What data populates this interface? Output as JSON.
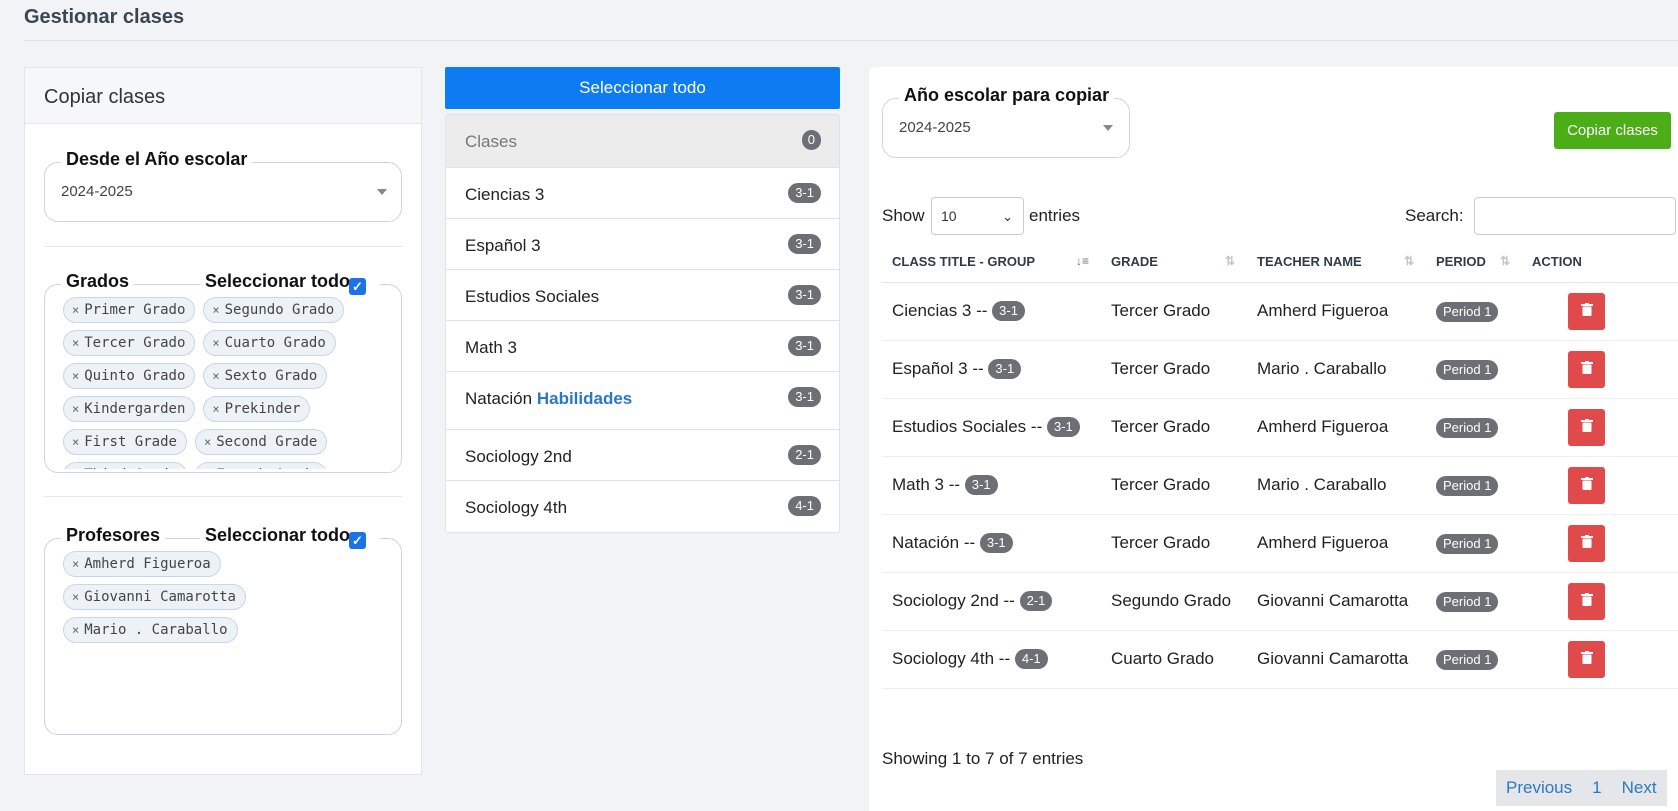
{
  "page": {
    "title": "Gestionar clases"
  },
  "left": {
    "card_title": "Copiar clases",
    "year_field": {
      "legend": "Desde el Año escolar",
      "value": "2024-2025"
    },
    "grades": {
      "legend": "Grados",
      "select_all_label": "Seleccionar todo",
      "chips": [
        "Primer Grado",
        "Segundo Grado",
        "Tercer Grado",
        "Cuarto Grado",
        "Quinto Grado",
        "Sexto Grado",
        "Kindergarden",
        "Prekinder",
        "First Grade",
        "Second Grade",
        "Third Grade",
        "Fourth Grade"
      ]
    },
    "teachers": {
      "legend": "Profesores",
      "select_all_label": "Seleccionar todo",
      "chips": [
        "Amherd Figueroa",
        "Giovanni Camarotta",
        "Mario . Caraballo"
      ]
    }
  },
  "middle": {
    "select_all_button": "Seleccionar todo",
    "header": {
      "label": "Clases",
      "count": "0"
    },
    "items": [
      {
        "name": "Ciencias 3",
        "highlight": "",
        "group": "3-1"
      },
      {
        "name": "Español 3",
        "highlight": "",
        "group": "3-1"
      },
      {
        "name": "Estudios Sociales",
        "highlight": "",
        "group": "3-1"
      },
      {
        "name": "Math 3",
        "highlight": "",
        "group": "3-1"
      },
      {
        "name": "Natación",
        "highlight": "Habilidades",
        "group": "3-1"
      },
      {
        "name": "Sociology 2nd",
        "highlight": "",
        "group": "2-1"
      },
      {
        "name": "Sociology 4th",
        "highlight": "",
        "group": "4-1"
      }
    ]
  },
  "right": {
    "year_field": {
      "legend": "Año escolar para copiar",
      "value": "2024-2025"
    },
    "copy_button": "Copiar clases",
    "show_label": "Show",
    "entries_label": "entries",
    "page_length": "10",
    "search_label": "Search:",
    "columns": [
      "CLASS TITLE - GROUP",
      "GRADE",
      "TEACHER NAME",
      "PERIOD",
      "ACTION"
    ],
    "rows": [
      {
        "title": "Ciencias 3 --",
        "group": "3-1",
        "grade": "Tercer Grado",
        "teacher": "Amherd Figueroa",
        "period": "Period 1"
      },
      {
        "title": "Español 3 --",
        "group": "3-1",
        "grade": "Tercer Grado",
        "teacher": "Mario . Caraballo",
        "period": "Period 1"
      },
      {
        "title": "Estudios Sociales --",
        "group": "3-1",
        "grade": "Tercer Grado",
        "teacher": "Amherd Figueroa",
        "period": "Period 1"
      },
      {
        "title": "Math 3 --",
        "group": "3-1",
        "grade": "Tercer Grado",
        "teacher": "Mario . Caraballo",
        "period": "Period 1"
      },
      {
        "title": "Natación --",
        "group": "3-1",
        "grade": "Tercer Grado",
        "teacher": "Amherd Figueroa",
        "period": "Period 1"
      },
      {
        "title": "Sociology 2nd --",
        "group": "2-1",
        "grade": "Segundo Grado",
        "teacher": "Giovanni Camarotta",
        "period": "Period 1"
      },
      {
        "title": "Sociology 4th --",
        "group": "4-1",
        "grade": "Cuarto Grado",
        "teacher": "Giovanni Camarotta",
        "period": "Period 1"
      }
    ],
    "info": "Showing 1 to 7 of 7 entries",
    "pager": {
      "previous": "Previous",
      "current": "1",
      "next": "Next"
    }
  },
  "icons": {
    "sort": "sort-icon",
    "delete": "trash-icon",
    "check": "checkmark-icon",
    "remove": "close-icon"
  },
  "colors": {
    "primary": "#0d7cf2",
    "success": "#4cae17",
    "danger": "#e04a4a",
    "badge": "#6c6f73"
  }
}
